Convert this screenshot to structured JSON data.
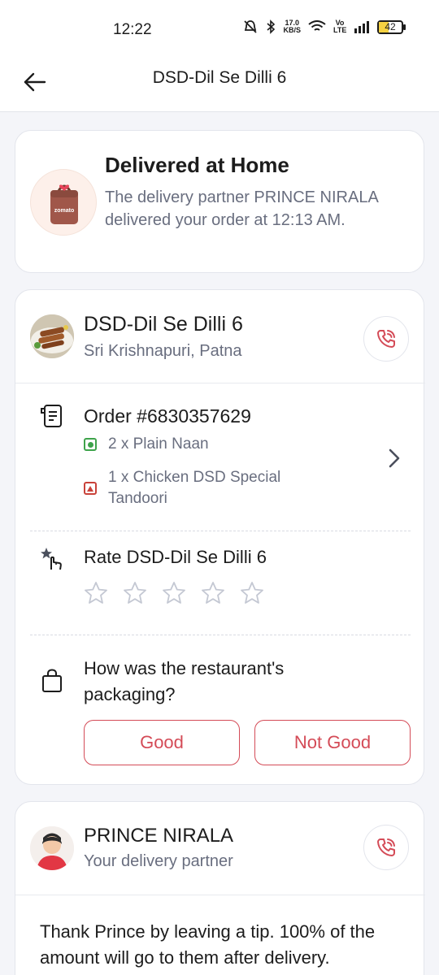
{
  "status_bar": {
    "time": "12:22",
    "net_speed_value": "17.0",
    "net_speed_unit": "KB/S",
    "volte": "Vo LTE",
    "battery": "42"
  },
  "header": {
    "title": "DSD-Dil Se Dilli 6"
  },
  "delivery": {
    "title": "Delivered at Home",
    "description": "The delivery partner PRINCE NIRALA delivered your order at 12:13 AM.",
    "bag_brand": "zomato"
  },
  "restaurant": {
    "name": "DSD-Dil Se Dilli 6",
    "location": "Sri Krishnapuri, Patna"
  },
  "order": {
    "title": "Order #6830357629",
    "items": [
      {
        "text": "2 x Plain Naan",
        "type": "veg"
      },
      {
        "text": "1 x Chicken DSD Special Tandoori",
        "type": "non-veg"
      }
    ]
  },
  "rating": {
    "title": "Rate DSD-Dil Se Dilli 6",
    "star_count": 5,
    "selected": 0
  },
  "packaging": {
    "question": "How was the restaurant's packaging?",
    "good_label": "Good",
    "not_good_label": "Not Good"
  },
  "rider": {
    "name": "PRINCE NIRALA",
    "role": "Your delivery partner",
    "tip_text": "Thank Prince by leaving a tip. 100% of the amount will go to them after delivery."
  },
  "colors": {
    "accent": "#d44b57",
    "veg": "#3ea34b",
    "non_veg": "#c9423a",
    "muted_text": "#696e7f"
  }
}
